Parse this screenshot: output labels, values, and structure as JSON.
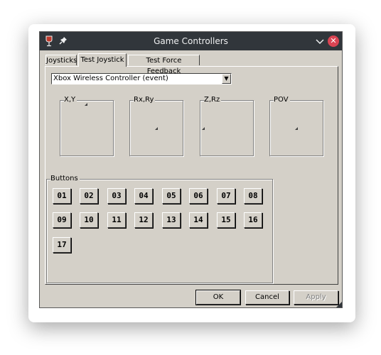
{
  "window": {
    "title": "Game Controllers",
    "icons": [
      "wine-glass-icon",
      "pin-icon",
      "chevron-down-icon",
      "close-icon"
    ]
  },
  "tabs": [
    {
      "label": "Joysticks",
      "active": false
    },
    {
      "label": "Test Joystick",
      "active": true
    },
    {
      "label": "Test Force Feedback",
      "active": false
    }
  ],
  "device_select": {
    "value": "Xbox Wireless Controller (event)"
  },
  "axes": [
    {
      "label": "X,Y"
    },
    {
      "label": "Rx,Ry"
    },
    {
      "label": "Z,Rz"
    },
    {
      "label": "POV"
    }
  ],
  "buttons_group": {
    "label": "Buttons",
    "buttons": [
      "01",
      "02",
      "03",
      "04",
      "05",
      "06",
      "07",
      "08",
      "09",
      "10",
      "11",
      "12",
      "13",
      "14",
      "15",
      "16",
      "17"
    ]
  },
  "dialog_buttons": {
    "ok": "OK",
    "cancel": "Cancel",
    "apply": "Apply"
  },
  "colors": {
    "face": "#d4d0c8",
    "titlebar": "#31363b",
    "close": "#da4453"
  }
}
